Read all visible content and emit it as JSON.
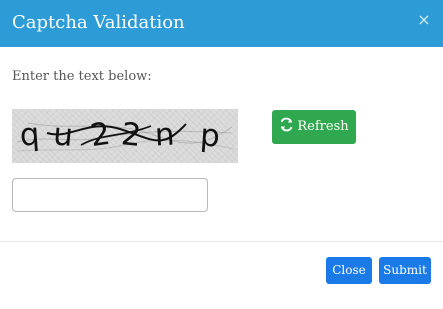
{
  "modal": {
    "title": "Captcha Validation",
    "close_symbol": "×",
    "prompt": "Enter the text below:",
    "captcha": {
      "text": "qu22np",
      "characters": [
        "q",
        "u",
        "2",
        "2",
        "n",
        "p"
      ]
    },
    "refresh": {
      "label": "Refresh",
      "icon": "refresh-icon"
    },
    "input": {
      "value": "",
      "placeholder": ""
    },
    "footer": {
      "close_label": "Close",
      "submit_label": "Submit"
    },
    "colors": {
      "header": "#2c9bd6",
      "refresh": "#2fa84f",
      "primary_buttons": "#1a7ae8"
    }
  }
}
